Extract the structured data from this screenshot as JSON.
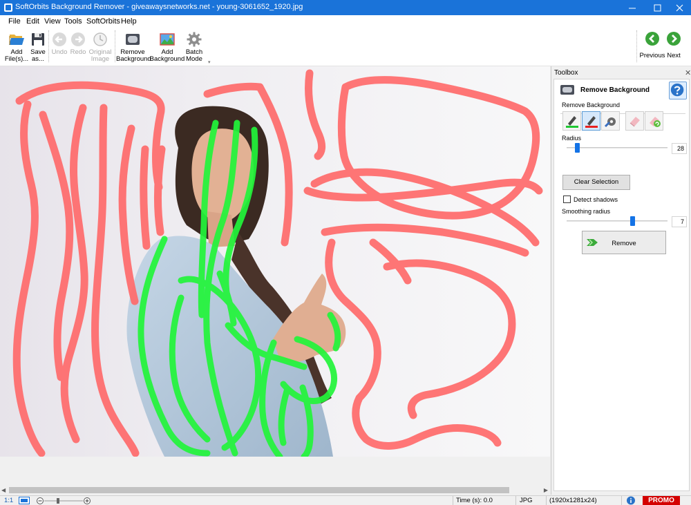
{
  "window": {
    "title": "SoftOrbits Background Remover - giveawaysnetworks.net - young-3061652_1920.jpg"
  },
  "menu": {
    "items": [
      {
        "label": "File"
      },
      {
        "label": "Edit"
      },
      {
        "label": "View"
      },
      {
        "label": "Tools"
      },
      {
        "label": "SoftOrbits"
      },
      {
        "label": "Help"
      }
    ]
  },
  "ribbon": {
    "add_files": "Add\nFile(s)...",
    "save_as": "Save\nas...",
    "undo": "Undo",
    "redo": "Redo",
    "original_image": "Original\nImage",
    "remove_background": "Remove\nBackground",
    "add_background": "Add\nBackground",
    "batch_mode": "Batch\nMode",
    "previous": "Previous",
    "next": "Next"
  },
  "toolbox": {
    "header": "Toolbox",
    "title": "Remove Background",
    "group_label": "Remove Background",
    "radius_label": "Radius",
    "radius_value": "28",
    "clear_selection": "Clear Selection",
    "detect_shadows": "Detect shadows",
    "detect_shadows_checked": false,
    "smoothing_label": "Smoothing radius",
    "smoothing_value": "7",
    "remove": "Remove"
  },
  "status": {
    "zoom_ratio": "1:1",
    "time": "Time (s): 0.0",
    "format": "JPG",
    "dimensions": "(1920x1281x24)",
    "promo": "PROMO"
  },
  "colors": {
    "titlebar": "#1a73d9",
    "keep_stroke": "#22f53a",
    "remove_stroke": "#ff6b6b",
    "slider": "#1473e6",
    "promo": "#d40000"
  },
  "icons": {
    "add_files": "folder-open-icon",
    "save_as": "floppy-disk-icon",
    "undo": "undo-icon",
    "redo": "redo-icon",
    "original_image": "clock-icon",
    "remove_background": "remove-background-icon",
    "add_background": "landscape-picture-icon",
    "batch_mode": "gear-icon",
    "previous": "arrow-left-icon",
    "next": "arrow-right-icon",
    "help": "question-mark-icon"
  }
}
